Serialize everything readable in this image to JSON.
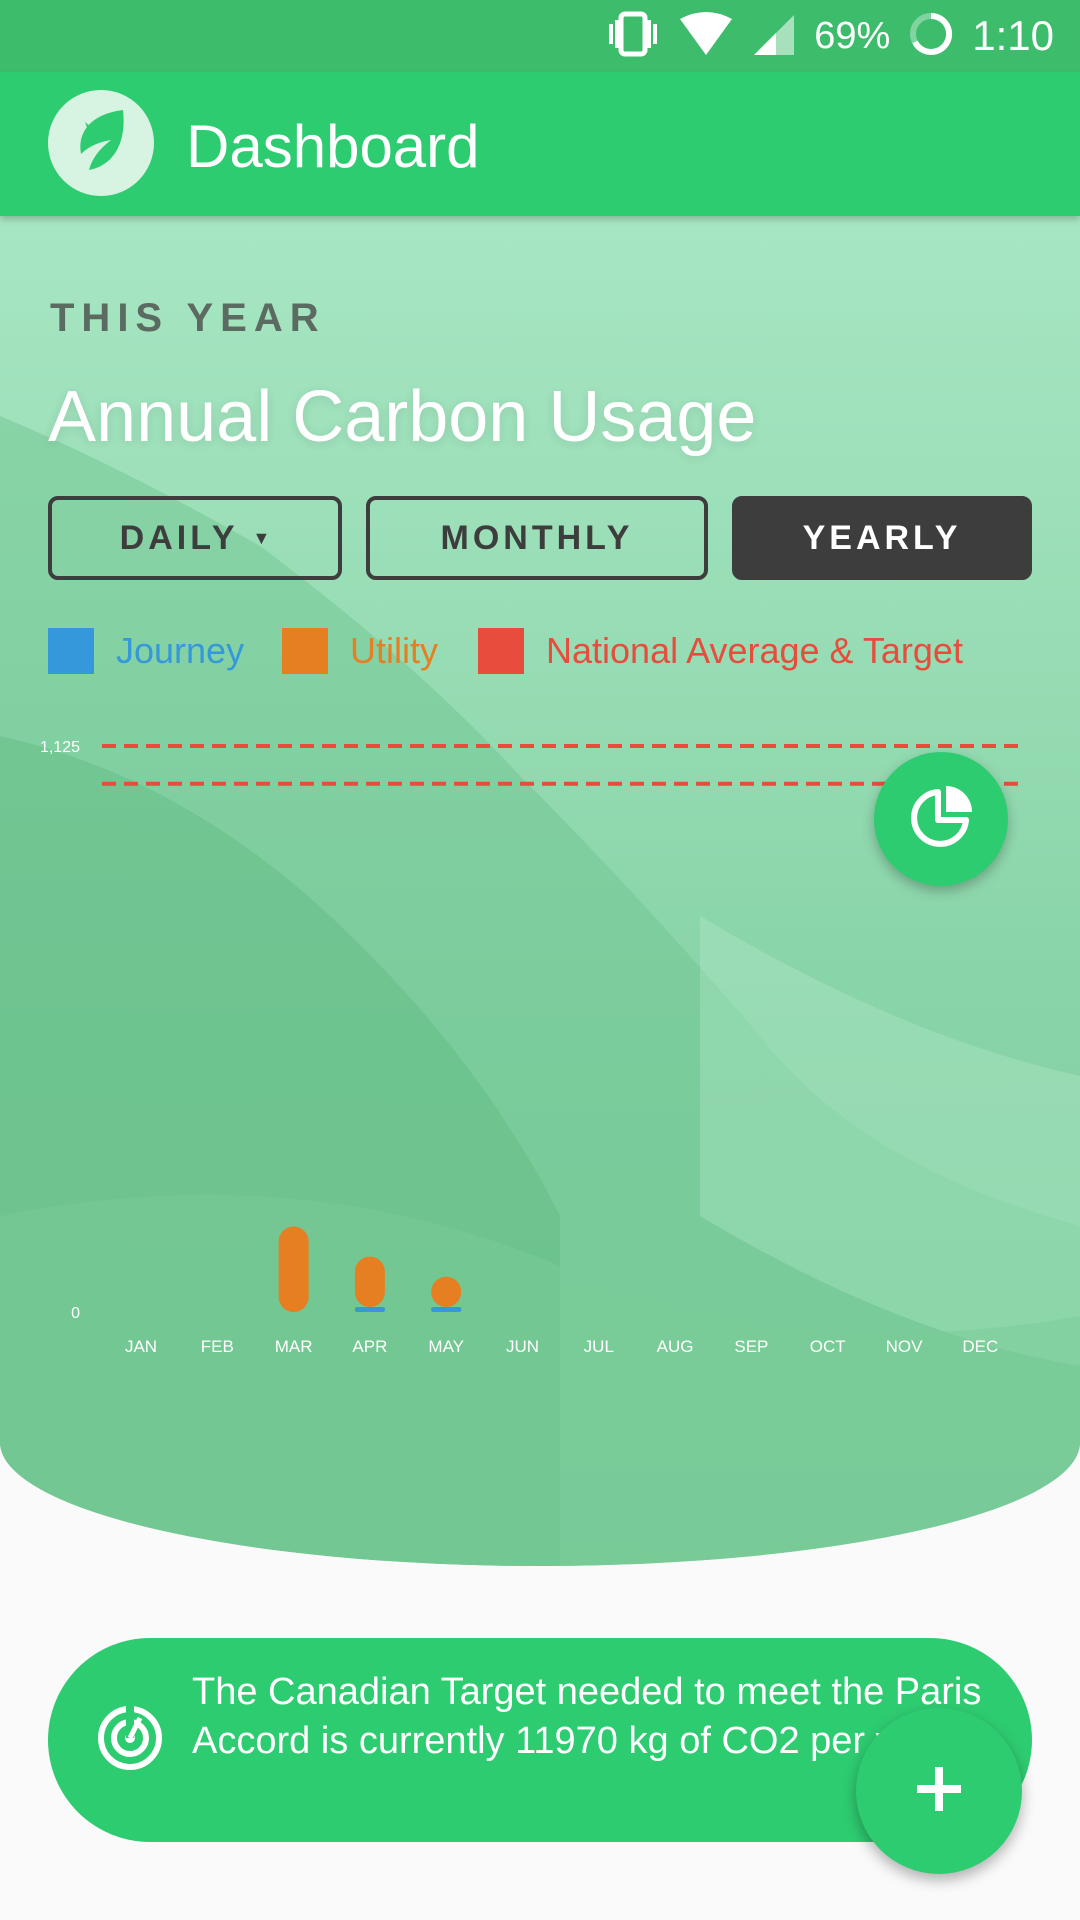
{
  "status_bar": {
    "battery": "69%",
    "time": "1:10"
  },
  "app_bar": {
    "title": "Dashboard",
    "logo_icon": "leaf-icon"
  },
  "section": {
    "eyebrow": "THIS YEAR",
    "heading": "Annual Carbon Usage"
  },
  "period_tabs": [
    {
      "label": "DAILY",
      "has_dropdown": true,
      "selected": false
    },
    {
      "label": "MONTHLY",
      "has_dropdown": false,
      "selected": false
    },
    {
      "label": "YEARLY",
      "has_dropdown": false,
      "selected": true
    }
  ],
  "legend": [
    {
      "label": "Journey",
      "color": "#3498db"
    },
    {
      "label": "Utility",
      "color": "#e67e22"
    },
    {
      "label": "National Average & Target",
      "color": "#e74c3c"
    }
  ],
  "chart_data": {
    "type": "bar",
    "stacked": true,
    "categories": [
      "JAN",
      "FEB",
      "MAR",
      "APR",
      "MAY",
      "JUN",
      "JUL",
      "AUG",
      "SEP",
      "OCT",
      "NOV",
      "DEC"
    ],
    "series": [
      {
        "name": "Journey",
        "color": "#3498db",
        "values": [
          0,
          0,
          0,
          10,
          10,
          0,
          0,
          0,
          0,
          0,
          0,
          0
        ]
      },
      {
        "name": "Utility",
        "color": "#e67e22",
        "values": [
          0,
          0,
          170,
          100,
          60,
          0,
          0,
          0,
          0,
          0,
          0,
          0
        ]
      }
    ],
    "reference_lines": [
      {
        "name": "National Average & Target",
        "color": "#e74c3c",
        "value": 1125
      },
      {
        "name": "National Average & Target",
        "color": "#e74c3c",
        "value": 1050
      }
    ],
    "y_ticks": [
      "1,125",
      "0"
    ],
    "ylim": [
      0,
      1125
    ]
  },
  "fab_chart": {
    "icon": "pie-chart-icon"
  },
  "info_card": {
    "icon": "target-icon",
    "text": "The Canadian Target needed to meet the Paris Accord is currently 11970 kg of CO2 per year"
  },
  "fab_add": {
    "icon": "plus-icon"
  },
  "colors": {
    "primary": "#2ecc71",
    "status_bar": "#3dbd6c",
    "dark": "#3d3d3d"
  }
}
